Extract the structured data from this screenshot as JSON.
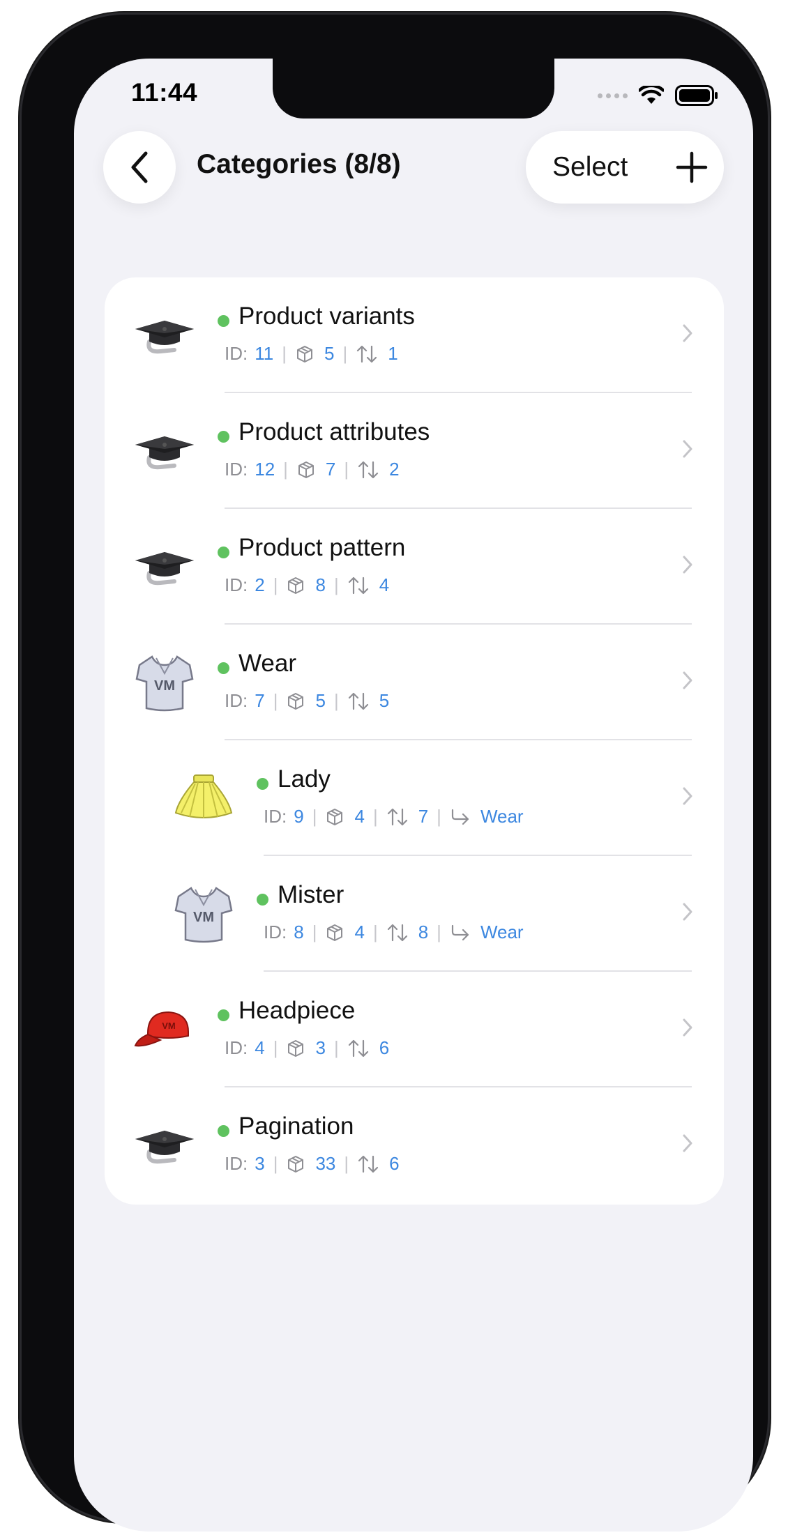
{
  "status": {
    "time": "11:44"
  },
  "nav": {
    "title": "Categories (8/8)",
    "select_label": "Select"
  },
  "colors": {
    "accent": "#3c87e0",
    "active_dot": "#5fc25f",
    "background": "#f2f2f7"
  },
  "categories": [
    {
      "name": "Product variants",
      "id": "11",
      "products": "5",
      "sort": "1",
      "parent": null,
      "icon": "graduation-cap-icon",
      "level": 0
    },
    {
      "name": "Product attributes",
      "id": "12",
      "products": "7",
      "sort": "2",
      "parent": null,
      "icon": "graduation-cap-icon",
      "level": 0
    },
    {
      "name": "Product pattern",
      "id": "2",
      "products": "8",
      "sort": "4",
      "parent": null,
      "icon": "graduation-cap-icon",
      "level": 0
    },
    {
      "name": "Wear",
      "id": "7",
      "products": "5",
      "sort": "5",
      "parent": null,
      "icon": "tshirt-icon",
      "level": 0
    },
    {
      "name": "Lady",
      "id": "9",
      "products": "4",
      "sort": "7",
      "parent": "Wear",
      "icon": "skirt-icon",
      "level": 1
    },
    {
      "name": "Mister",
      "id": "8",
      "products": "4",
      "sort": "8",
      "parent": "Wear",
      "icon": "tshirt-icon",
      "level": 1
    },
    {
      "name": "Headpiece",
      "id": "4",
      "products": "3",
      "sort": "6",
      "parent": null,
      "icon": "cap-icon",
      "level": 0
    },
    {
      "name": "Pagination",
      "id": "3",
      "products": "33",
      "sort": "6",
      "parent": null,
      "icon": "graduation-cap-icon",
      "level": 0
    }
  ],
  "labels": {
    "id_prefix": "ID:"
  }
}
